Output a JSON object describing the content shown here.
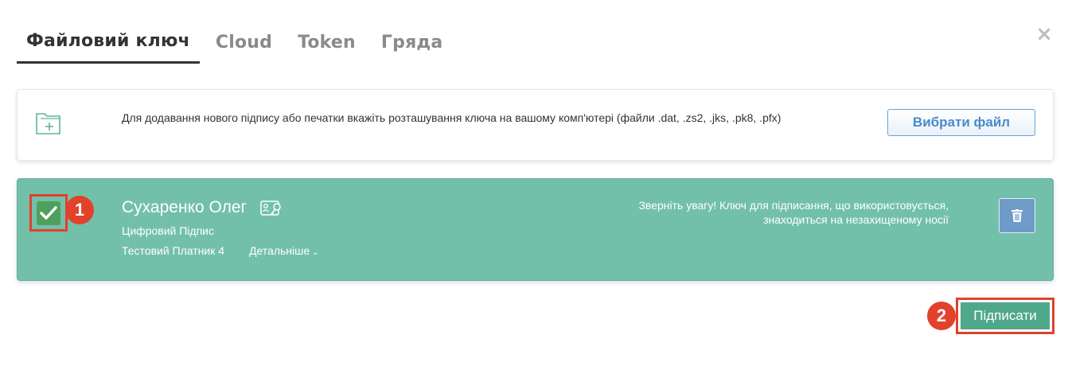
{
  "tabs": [
    {
      "label": "Файловий ключ",
      "active": true
    },
    {
      "label": "Cloud",
      "active": false
    },
    {
      "label": "Token",
      "active": false
    },
    {
      "label": "Гряда",
      "active": false
    }
  ],
  "close_label": "×",
  "upload": {
    "icon": "folder-add-icon",
    "text": "Для додавання нового підпису або печатки вкажіть розташування ключа на вашому комп'ютері (файли .dat, .zs2, .jks, .pk8, .pfx)",
    "button_label": "Вибрати файл"
  },
  "key": {
    "checked": true,
    "owner": "Сухаренко Олег",
    "owner_icon": "id-card-key-icon",
    "type": "Цифровий Підпис",
    "issuer": "Тестовий Платник 4",
    "details_label": "Детальніше",
    "details_icon": "chevron-down-icon",
    "warning": "Зверніть увагу! Ключ для підписання, що використовується, знаходиться на незахищеному носії",
    "delete_icon": "trash-icon"
  },
  "annotations": {
    "badge_1": "1",
    "badge_2": "2"
  },
  "sign_label": "Підписати",
  "colors": {
    "card_green": "#72c0a9",
    "accent_red": "#e2412c",
    "button_blue": "#4a8ac8",
    "sign_green": "#4fa88a"
  }
}
